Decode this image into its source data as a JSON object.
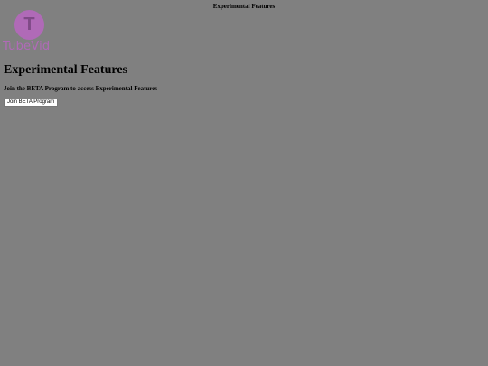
{
  "page": {
    "window_title": "Experimental Features"
  },
  "logo": {
    "letter": "T",
    "wordmark": "TubeVid",
    "icon": "tubevid-logo-icon",
    "color": "#b06ab7"
  },
  "main": {
    "heading": "Experimental Features",
    "subtitle": "Join the BETA Program to access Experimental Features",
    "join_button_label": "Join BETA Program"
  },
  "colors": {
    "background": "#808080",
    "text": "#000000",
    "button_background": "#ffffff"
  }
}
